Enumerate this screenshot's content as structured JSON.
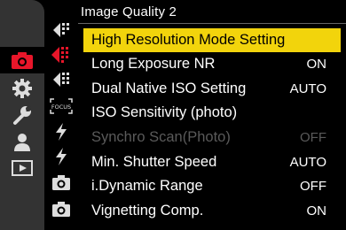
{
  "header": {
    "title": "Image Quality 2"
  },
  "main_tabs": [
    {
      "icon": "camera-icon",
      "active": true
    },
    {
      "icon": "gear-icon",
      "active": false
    },
    {
      "icon": "wrench-icon",
      "active": false
    },
    {
      "icon": "person-icon",
      "active": false
    },
    {
      "icon": "playback-icon",
      "active": false
    }
  ],
  "sub_tabs": [
    {
      "icon": "image-quality-1-icon"
    },
    {
      "icon": "image-quality-2-icon",
      "active": true
    },
    {
      "icon": "image-quality-3-icon"
    },
    {
      "icon": "focus-icon",
      "label": "FOCUS"
    },
    {
      "icon": "flash-icon"
    },
    {
      "icon": "flash-icon"
    },
    {
      "icon": "camera-1-icon"
    },
    {
      "icon": "camera-2-icon"
    }
  ],
  "menu": {
    "items": [
      {
        "label": "High Resolution Mode Setting",
        "value": ""
      },
      {
        "label": "Long Exposure NR",
        "value": "ON"
      },
      {
        "label": "Dual Native ISO Setting",
        "value": "AUTO"
      },
      {
        "label": "ISO Sensitivity (photo)",
        "value": ""
      },
      {
        "label": "Synchro Scan(Photo)",
        "value": "OFF"
      },
      {
        "label": "Min. Shutter Speed",
        "value": "AUTO"
      },
      {
        "label": "i.Dynamic Range",
        "value": "OFF"
      },
      {
        "label": "Vignetting Comp.",
        "value": "ON"
      }
    ]
  },
  "colors": {
    "highlight": "#f2d40c",
    "accent_red": "#e8162a",
    "disabled": "#5a5a5a"
  }
}
